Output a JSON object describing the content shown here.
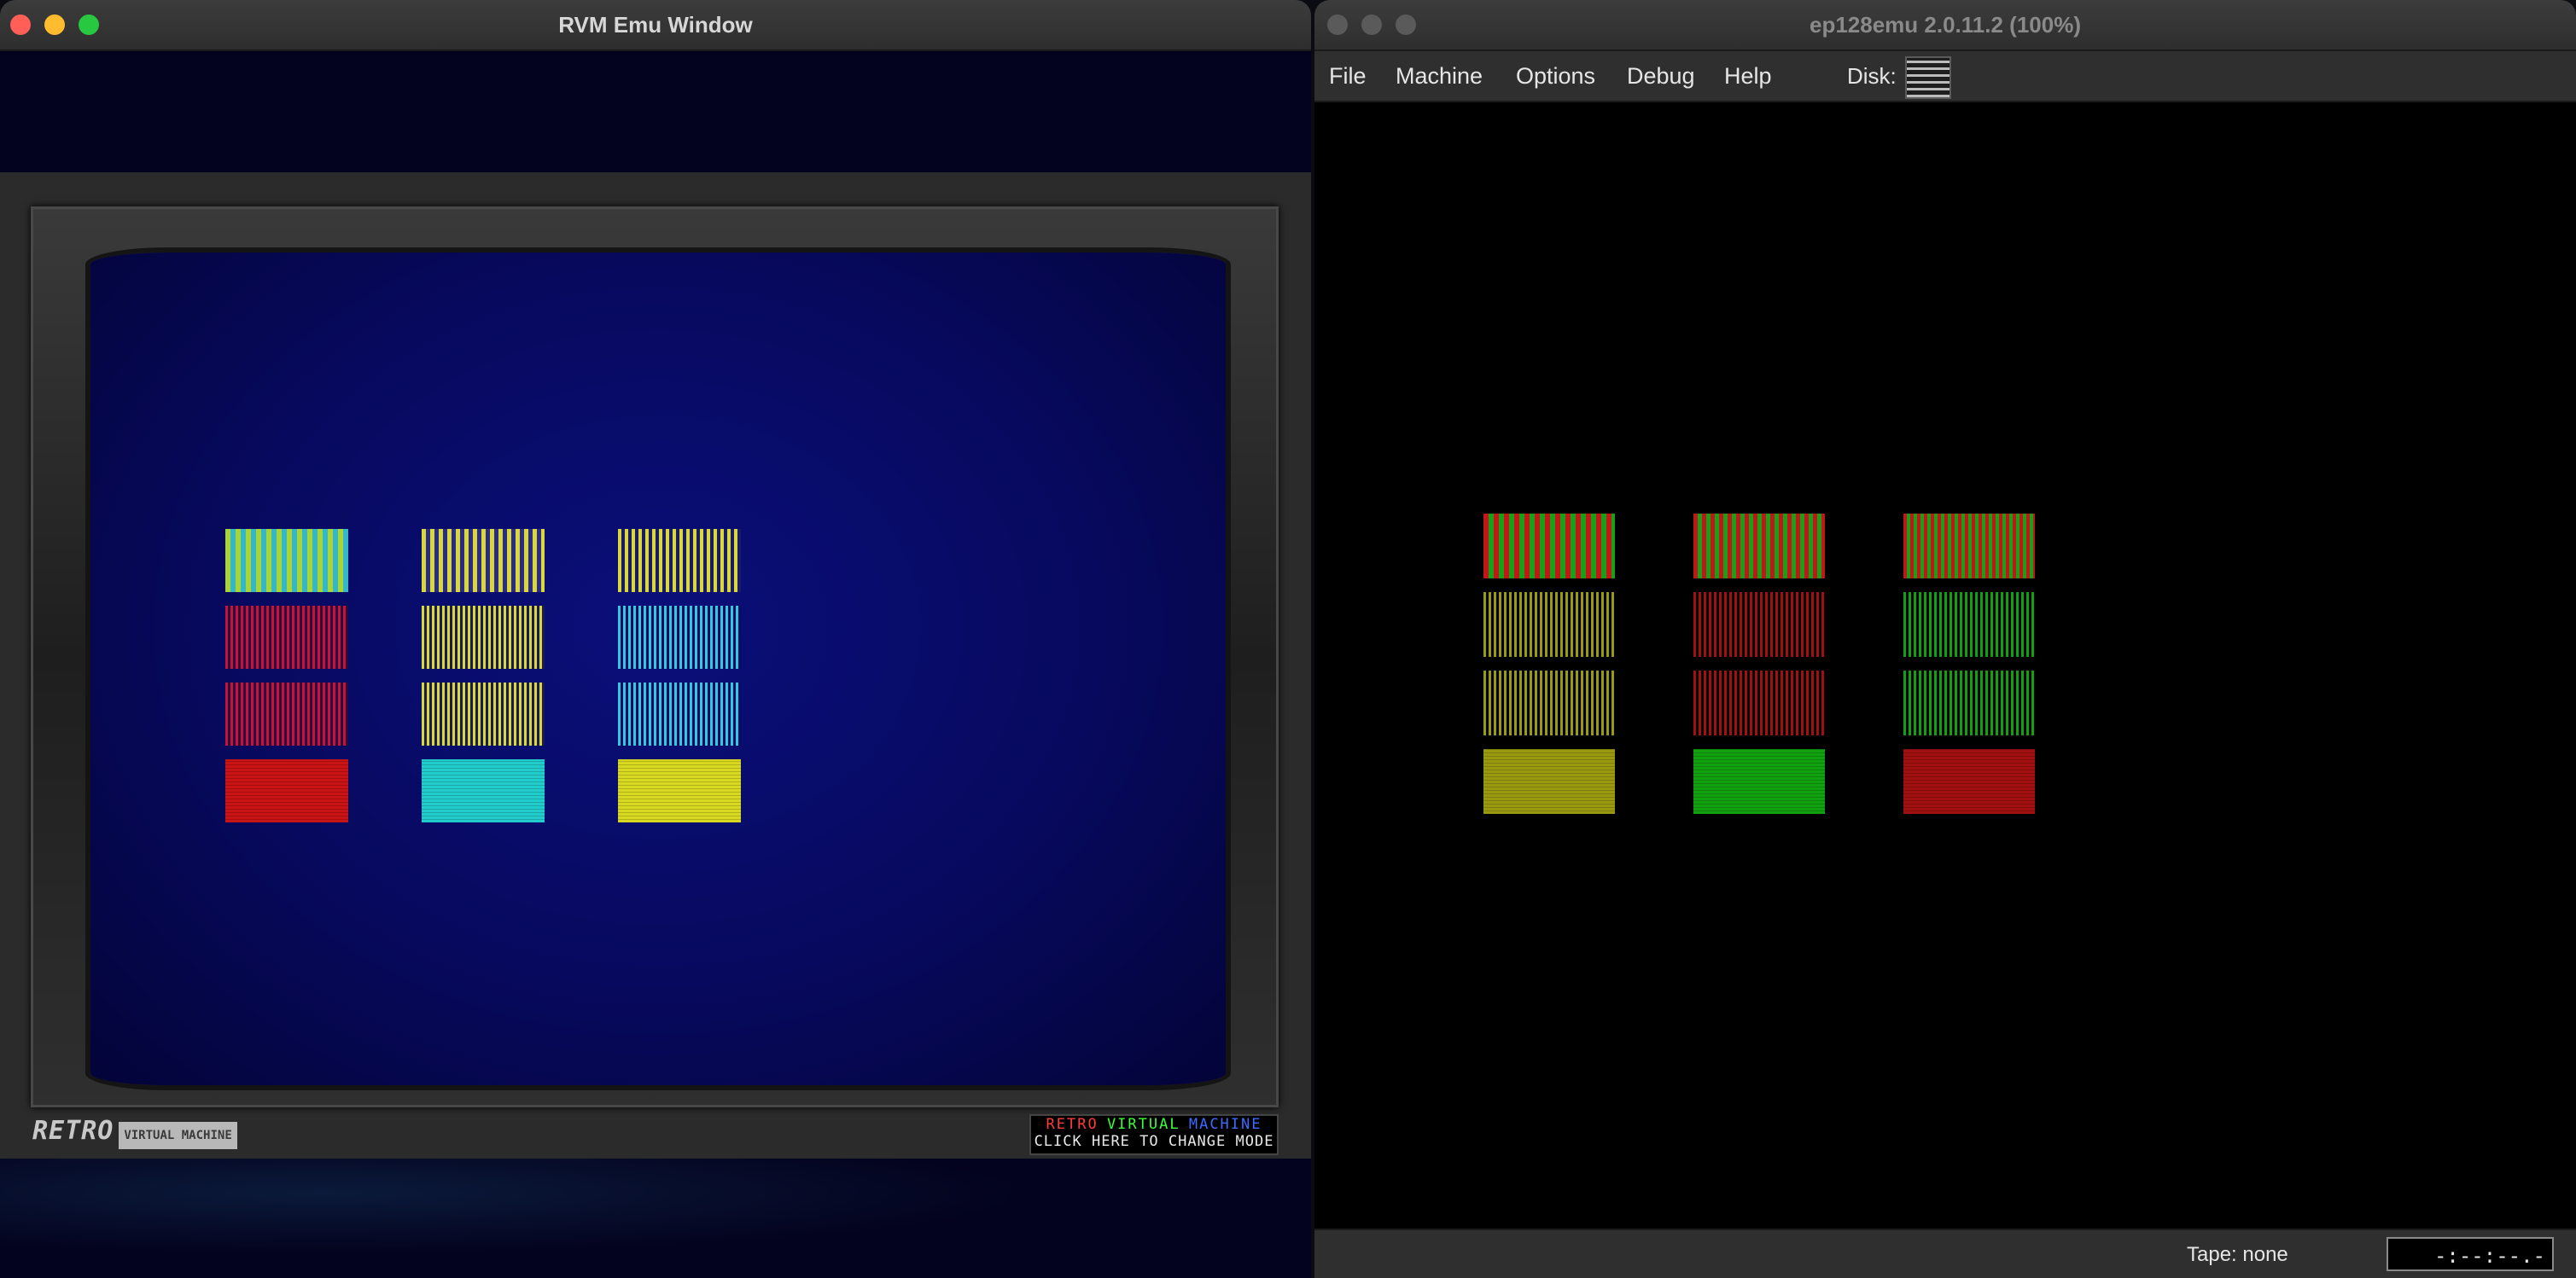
{
  "rvm_window": {
    "title": "RVM Emu Window",
    "logo_main": "RETRO",
    "logo_sub": "VIRTUAL MACHINE",
    "mode_box": {
      "line1_words": [
        {
          "text": "RETRO",
          "color": "#ff3b3b"
        },
        {
          "text": "VIRTUAL",
          "color": "#3bff3b"
        },
        {
          "text": "MACHINE",
          "color": "#3b6bff"
        }
      ],
      "line2": "CLICK HERE TO CHANGE MODE"
    },
    "color_bars": {
      "columns": [
        {
          "rows": [
            {
              "pattern": "stripes",
              "colors": [
                "#a8d43a",
                "#34b8c8"
              ]
            },
            {
              "pattern": "stripes",
              "colors": [
                "#c4143a",
                "#2a0a40"
              ]
            },
            {
              "pattern": "stripes",
              "colors": [
                "#c4143a",
                "#2a0a40"
              ]
            },
            {
              "pattern": "solid",
              "colors": [
                "#c81414"
              ]
            }
          ]
        },
        {
          "rows": [
            {
              "pattern": "stripes",
              "colors": [
                "#d8d838",
                "#2a2a8a"
              ]
            },
            {
              "pattern": "stripes",
              "colors": [
                "#d8d838",
                "#1a1a5a"
              ]
            },
            {
              "pattern": "stripes",
              "colors": [
                "#d8d838",
                "#1a1a5a"
              ]
            },
            {
              "pattern": "solid",
              "colors": [
                "#22cccc"
              ]
            }
          ]
        },
        {
          "rows": [
            {
              "pattern": "stripes",
              "colors": [
                "#d8d838",
                "#1a1a6a"
              ]
            },
            {
              "pattern": "stripes",
              "colors": [
                "#30c8e8",
                "#0a0a5a"
              ]
            },
            {
              "pattern": "stripes",
              "colors": [
                "#30c8e8",
                "#0a0a5a"
              ]
            },
            {
              "pattern": "solid",
              "colors": [
                "#d8d820"
              ]
            }
          ]
        }
      ]
    }
  },
  "ep_window": {
    "title": "ep128emu 2.0.11.2 (100%)",
    "menu": [
      "File",
      "Machine",
      "Options",
      "Debug",
      "Help"
    ],
    "disk_label": "Disk:",
    "tape_label": "Tape: none",
    "tape_counter": "-:--:--.-",
    "color_bars": {
      "columns": [
        {
          "rows": [
            {
              "pattern": "stripes",
              "colors": [
                "#c01818",
                "#18a018"
              ]
            },
            {
              "pattern": "stripes",
              "colors": [
                "#9a9a10",
                "#000000"
              ]
            },
            {
              "pattern": "stripes",
              "colors": [
                "#9a9a10",
                "#000000"
              ]
            },
            {
              "pattern": "solid",
              "colors": [
                "#9a9a10"
              ]
            }
          ]
        },
        {
          "rows": [
            {
              "pattern": "stripes",
              "colors": [
                "#c01818",
                "#18a018"
              ]
            },
            {
              "pattern": "stripes",
              "colors": [
                "#a01010",
                "#000000"
              ]
            },
            {
              "pattern": "stripes",
              "colors": [
                "#a01010",
                "#000000"
              ]
            },
            {
              "pattern": "solid",
              "colors": [
                "#10a010"
              ]
            }
          ]
        },
        {
          "rows": [
            {
              "pattern": "stripes",
              "colors": [
                "#c01818",
                "#18a018"
              ]
            },
            {
              "pattern": "stripes",
              "colors": [
                "#10a010",
                "#000000"
              ]
            },
            {
              "pattern": "stripes",
              "colors": [
                "#10a010",
                "#000000"
              ]
            },
            {
              "pattern": "solid",
              "colors": [
                "#a01010"
              ]
            }
          ]
        }
      ]
    }
  }
}
